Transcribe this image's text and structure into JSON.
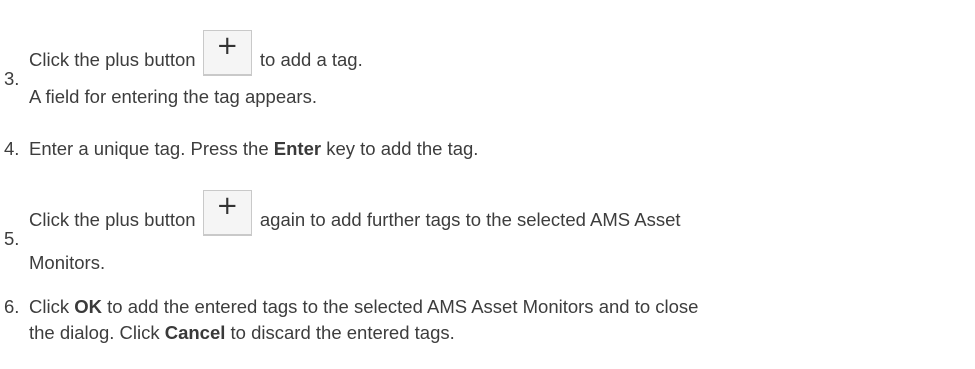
{
  "steps": [
    {
      "number": "3.",
      "line1_before": "Click the plus button",
      "plus_icon": "plus-icon",
      "plus_glyph": "+",
      "line1_after": "to add a tag.",
      "line2": "A field for entering the tag appears."
    },
    {
      "number": "4.",
      "text_before": "Enter a unique tag. Press the ",
      "bold": "Enter",
      "text_after": " key to add the tag."
    },
    {
      "number": "5.",
      "line1_before": "Click the plus button",
      "plus_icon": "plus-icon",
      "plus_glyph": "+",
      "line1_after": "again to add further tags to the selected AMS Asset",
      "line2": "Monitors."
    },
    {
      "number": "6.",
      "line1_before": "Click ",
      "line1_bold": "OK",
      "line1_after": " to add the entered tags to the selected AMS Asset Monitors and to close",
      "line2_before": "the dialog. Click ",
      "line2_bold": "Cancel",
      "line2_after": " to discard the entered tags."
    }
  ]
}
